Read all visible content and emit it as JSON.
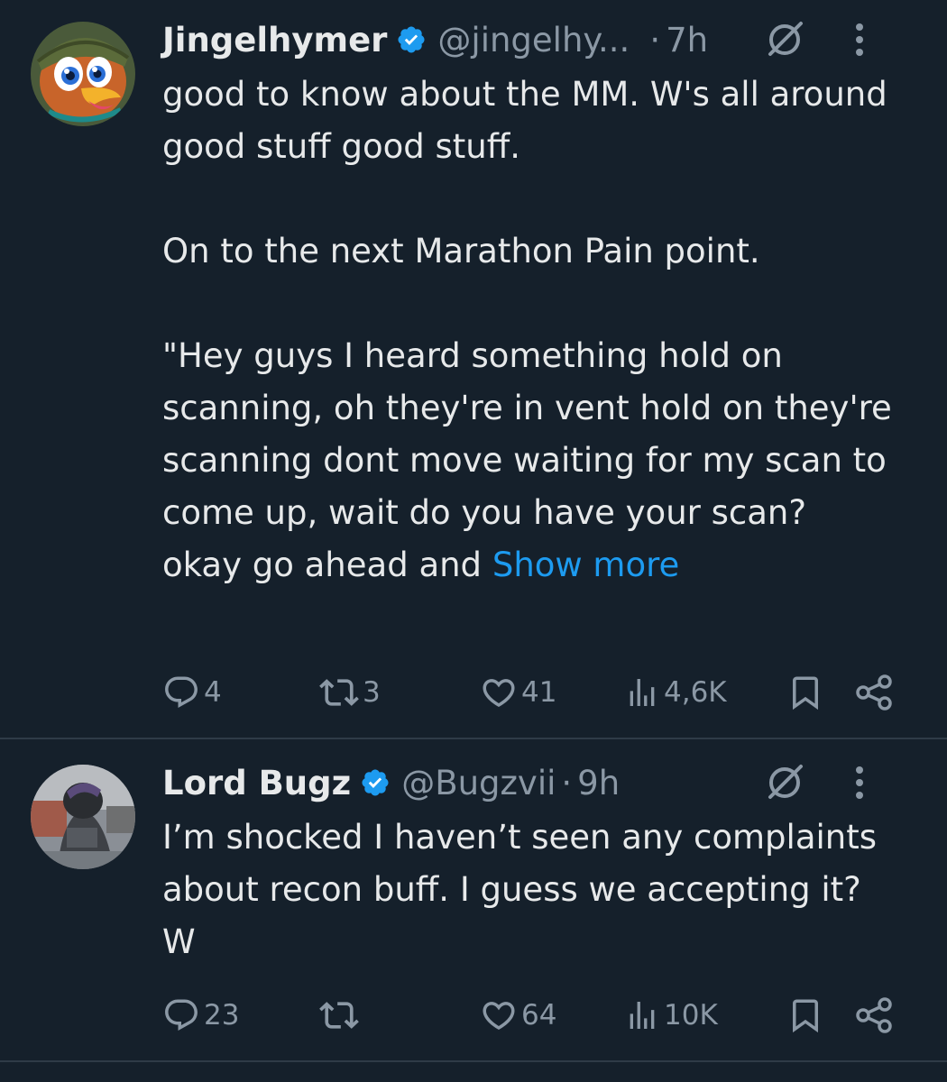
{
  "colors": {
    "background": "#15202b",
    "text": "#e7e9ea",
    "muted": "#8b98a5",
    "link": "#1d9bf0",
    "divider": "#2f3b47"
  },
  "tweets": [
    {
      "author_name": "Jingelhymer",
      "handle": "@jingelhy...",
      "separator": "·",
      "time": "7h",
      "verified": true,
      "avatar_icon": "cartoon-bird-avatar",
      "body_paragraphs": [
        "good to know about the MM. W's all around good stuff good stuff.",
        "On to the next Marathon Pain point.",
        "\"Hey guys I heard something hold on scanning, oh they're in vent hold on they're scanning dont move waiting for my scan to come up, wait do you have your scan? okay go ahead and"
      ],
      "show_more": "Show more",
      "replies": "4",
      "reposts": "3",
      "likes": "41",
      "views": "4,6K"
    },
    {
      "author_name": "Lord Bugz",
      "handle": "@Bugzvii",
      "separator": "·",
      "time": "9h",
      "verified": true,
      "avatar_icon": "hooded-figure-avatar",
      "body_paragraphs": [
        "I’m shocked I haven’t seen any complaints about recon buff. I guess we accepting it? W"
      ],
      "replies": "23",
      "reposts": "",
      "likes": "64",
      "views": "10K"
    }
  ]
}
